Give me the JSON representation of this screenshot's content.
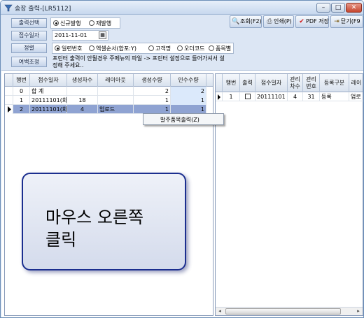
{
  "window": {
    "title": "송장 출력-[LR5112]",
    "min_glyph": "–",
    "max_glyph": "□",
    "close_glyph": "✕"
  },
  "controls": {
    "output_select_label": "출력선택",
    "output_options": [
      "신규발행",
      "재발행"
    ],
    "output_selected": 0,
    "receipt_date_label": "접수일자",
    "receipt_date_value": "2011-11-01",
    "sort_label": "정렬",
    "sort_options": [
      "일련번호",
      "엑셀순서(합포:Y)",
      "고객명",
      "오더코드",
      "품목별"
    ],
    "sort_selected": 0,
    "margin_button": "여백조정",
    "notice": "프린터 출력이 안될경우 주메뉴의 파일 -> 프린터 설정으로 들어가셔서 설정해 주세요.."
  },
  "toolbar": {
    "search": "조회(F2)",
    "print": "인쇄(P)",
    "pdf_save": "PDF 저장",
    "close": "닫기(F9"
  },
  "left_grid": {
    "columns": [
      "행번",
      "접수일자",
      "생성차수",
      "레이아웃",
      "생성수량",
      "인수수량"
    ],
    "rows": [
      [
        "0",
        "합   계",
        "",
        "",
        "2",
        "2"
      ],
      [
        "1",
        "20111101(화)",
        "18",
        "",
        "1",
        "1"
      ],
      [
        "2",
        "20111101(화)",
        "4",
        "업로드",
        "1",
        "1"
      ]
    ],
    "selected_row": 2
  },
  "right_grid": {
    "columns": [
      "행번",
      "출력",
      "접수일자",
      "관리\n차수",
      "관리\n번호",
      "등록구분",
      "레이"
    ],
    "rows": [
      [
        "1",
        "",
        "20111101",
        "4",
        "31",
        "등록",
        "업로"
      ]
    ]
  },
  "context_menu": {
    "item": "발주품목출력(Z)"
  },
  "annotation": {
    "line1": "마우스 오른쪽",
    "line2": "클릭"
  }
}
